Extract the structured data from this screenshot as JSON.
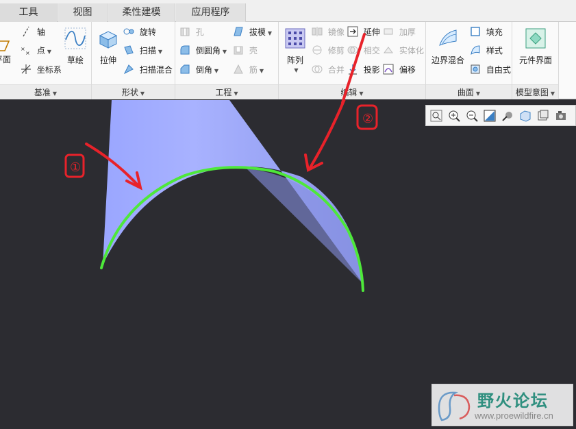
{
  "tabs": [
    {
      "label": "工具"
    },
    {
      "label": "视图"
    },
    {
      "label": "柔性建模"
    },
    {
      "label": "应用程序"
    }
  ],
  "ribbon": {
    "datum": {
      "label": "基准",
      "items": {
        "plane": "平面",
        "axis": "轴",
        "point": "点",
        "csys": "坐标系",
        "sketch": "草绘"
      }
    },
    "shapes": {
      "label": "形状",
      "items": {
        "extrude": "拉伸",
        "revolve": "旋转",
        "sweep": "扫描",
        "swept_blend": "扫描混合"
      }
    },
    "engineering": {
      "label": "工程",
      "items": {
        "hole": "孔",
        "round": "倒圆角",
        "chamfer": "倒角",
        "draft": "拔模",
        "shell": "壳",
        "rib": "筋"
      }
    },
    "editing": {
      "label": "编辑",
      "items": {
        "pattern": "阵列",
        "mirror": "镜像",
        "trim": "修剪",
        "merge": "合并",
        "extend": "延伸",
        "intersect": "相交",
        "project": "投影",
        "thicken": "加厚",
        "solidify": "实体化",
        "offset": "偏移"
      }
    },
    "surfaces": {
      "label": "曲面",
      "items": {
        "boundary_blend": "边界混合",
        "fill": "填充",
        "style": "样式",
        "freestyle": "自由式"
      }
    },
    "model_intent": {
      "label": "模型意图",
      "items": {
        "component_interface": "元件界面"
      }
    }
  },
  "annotations": {
    "label1": "①",
    "label2": "②"
  },
  "watermark": {
    "title": "野火论坛",
    "url": "www.proewildfire.cn"
  },
  "colors": {
    "surface": "#a3aeff",
    "edge_highlight": "#4ee83a",
    "annotation": "#e8222a",
    "viewport_bg": "#2c2c31"
  }
}
